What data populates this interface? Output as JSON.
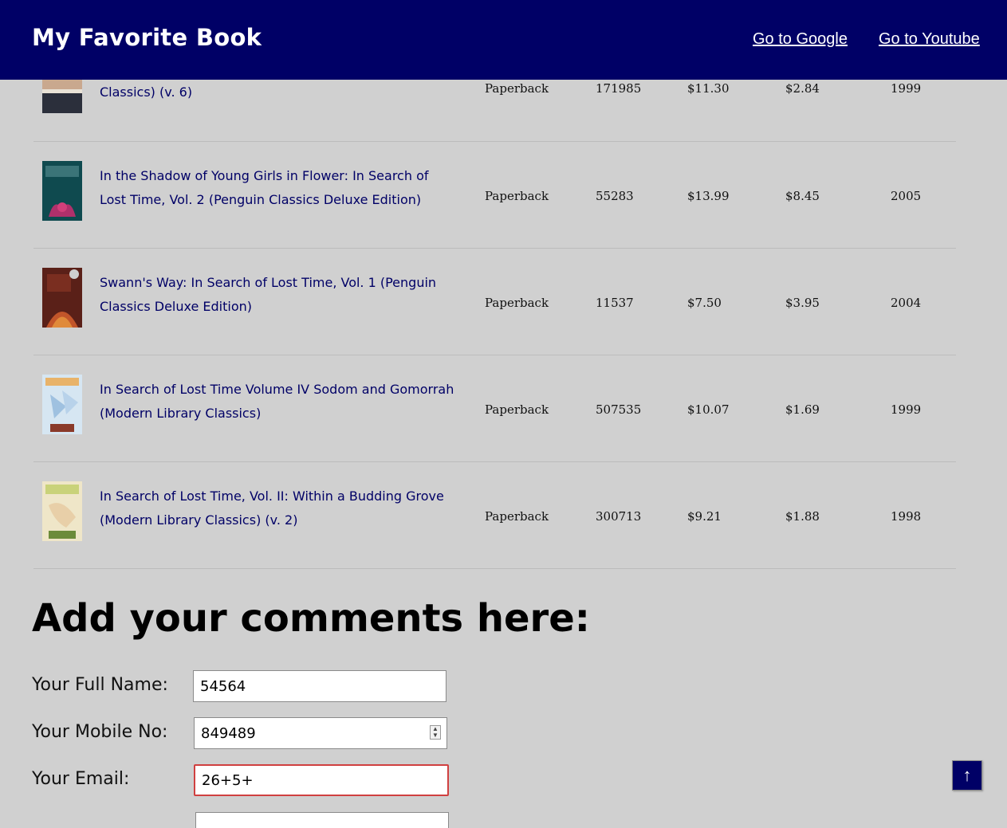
{
  "header": {
    "title": "My Favorite Book",
    "links": [
      "Go to Google",
      "Go to Youtube"
    ]
  },
  "books": [
    {
      "title_line2": "Classics) (v. 6)",
      "binding": "Paperback",
      "rank": "171985",
      "list_price": "$11.30",
      "used_price": "$2.84",
      "year": "1999"
    },
    {
      "title": "In the Shadow of Young Girls in Flower: In Search of Lost Time, Vol. 2 (Penguin Classics Deluxe Edition)",
      "binding": "Paperback",
      "rank": "55283",
      "list_price": "$13.99",
      "used_price": "$8.45",
      "year": "2005"
    },
    {
      "title": "Swann's Way: In Search of Lost Time, Vol. 1 (Penguin Classics Deluxe Edition)",
      "binding": "Paperback",
      "rank": "11537",
      "list_price": "$7.50",
      "used_price": "$3.95",
      "year": "2004"
    },
    {
      "title": "In Search of Lost Time Volume IV Sodom and Gomorrah (Modern Library Classics)",
      "binding": "Paperback",
      "rank": "507535",
      "list_price": "$10.07",
      "used_price": "$1.69",
      "year": "1999"
    },
    {
      "title": "In Search of Lost Time, Vol. II: Within a Budding Grove (Modern Library Classics) (v. 2)",
      "binding": "Paperback",
      "rank": "300713",
      "list_price": "$9.21",
      "used_price": "$1.88",
      "year": "1998"
    }
  ],
  "comments": {
    "heading": "Add your comments here:",
    "name_label": "Your Full Name:",
    "name_value": "54564",
    "mobile_label": "Your Mobile No:",
    "mobile_value": "849489",
    "email_label": "Your Email:",
    "email_value": "26+5+"
  },
  "scroll_top": {
    "icon": "arrow-up-icon",
    "glyph": "↑"
  },
  "colors": {
    "header_bg": "#000066",
    "link": "#000066",
    "page_bg": "#d0d0d0",
    "invalid_border": "#d04040"
  }
}
